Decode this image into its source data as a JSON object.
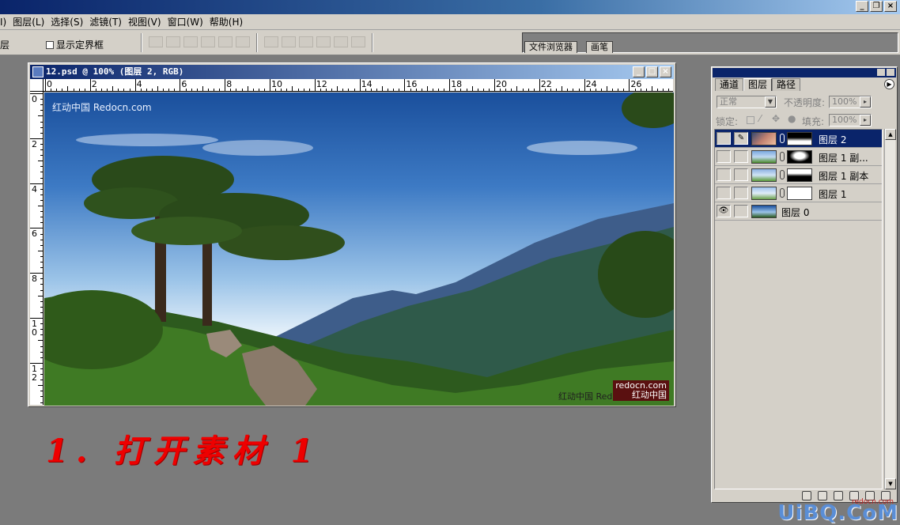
{
  "menubar": {
    "items": [
      "I)",
      "图层(L)",
      "选择(S)",
      "滤镜(T)",
      "视图(V)",
      "窗口(W)",
      "帮助(H)"
    ]
  },
  "options": {
    "leading_label": "层",
    "show_bounding_box": "显示定界框"
  },
  "palette_well": {
    "tabs": [
      "文件浏览器",
      "画笔"
    ]
  },
  "document": {
    "title": "12.psd @ 100% (图层 2, RGB)",
    "ruler_h": [
      "0",
      "2",
      "4",
      "6",
      "8",
      "10",
      "12",
      "14",
      "16",
      "18",
      "20",
      "22",
      "24",
      "26"
    ],
    "ruler_v": [
      "0",
      "2",
      "4",
      "6",
      "8",
      "1 0",
      "1 2"
    ],
    "watermark_top": "红动中国 Redocn.com",
    "watermark_bottom": "红动中国 Redo",
    "watermark_stamp_url": "redocn.com",
    "watermark_stamp": "红动中国"
  },
  "caption": "1. 打开素材 1",
  "layers_panel": {
    "tabs": [
      "通道",
      "图层",
      "路径"
    ],
    "active_tab": "图层",
    "blend_mode": "正常",
    "opacity_label": "不透明度:",
    "opacity_value": "100%",
    "lock_label": "锁定:",
    "fill_label": "填充:",
    "fill_value": "100%",
    "layers": [
      {
        "name": "图层 2",
        "selected": true,
        "visible": false,
        "has_mask": true
      },
      {
        "name": "图层 1 副...",
        "selected": false,
        "visible": false,
        "has_mask": true
      },
      {
        "name": "图层 1 副本",
        "selected": false,
        "visible": false,
        "has_mask": true
      },
      {
        "name": "图层 1",
        "selected": false,
        "visible": false,
        "has_mask": true
      },
      {
        "name": "图层 0",
        "selected": false,
        "visible": true,
        "has_mask": false
      }
    ]
  },
  "site_watermark": {
    "small": "redocn.com",
    "large": "UiBQ.CoM"
  },
  "colors": {
    "caption": "#ee0000",
    "selected_layer": "#0a246a",
    "title_gradient_start": "#0a246a"
  }
}
